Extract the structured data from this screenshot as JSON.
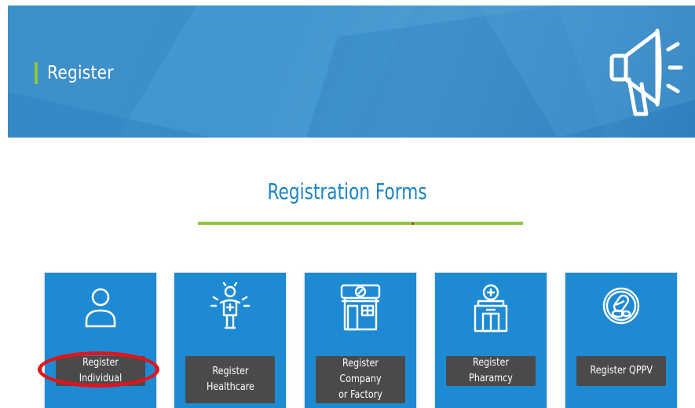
{
  "banner": {
    "title": "Register",
    "icon": "megaphone-icon",
    "accent_color": "#8dc63f",
    "background_color": "#3a8cc7"
  },
  "section": {
    "title": "Registration Forms",
    "title_color": "#1b84c4",
    "underline_color": "#8dc63f"
  },
  "cards": [
    {
      "label": "Register Individual",
      "icon": "person-icon"
    },
    {
      "label": "Register\nHealthcare",
      "icon": "healthcare-worker-icon"
    },
    {
      "label": "Register Company\nor Factory",
      "icon": "factory-icon"
    },
    {
      "label": "Register Pharamcy",
      "icon": "pharmacy-icon"
    },
    {
      "label": "Register QPPV",
      "icon": "pills-icon"
    }
  ],
  "card_color": "#1e8ad3",
  "button_color": "#4a4a4a",
  "annotation": {
    "shape": "red-ellipse",
    "target": "Register Individual",
    "color": "#e0141b"
  }
}
